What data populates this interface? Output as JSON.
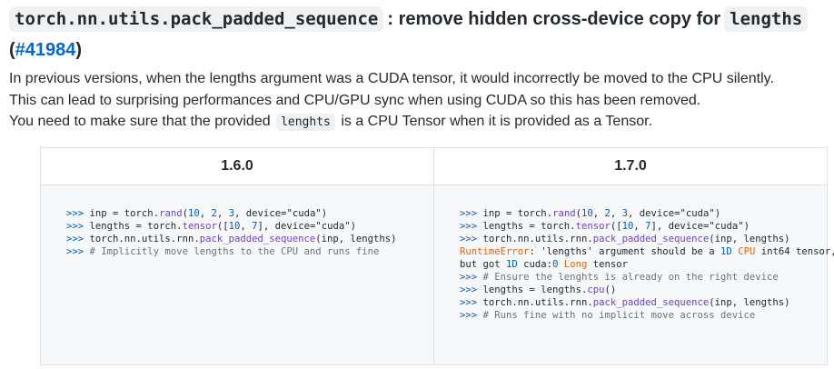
{
  "heading": {
    "code_fn": "torch.nn.utils.pack_padded_sequence",
    "text": ": remove hidden cross-device copy for",
    "code_arg": "lengths",
    "paren_open": "(",
    "link": "#41984",
    "paren_close": ")"
  },
  "paragraph": {
    "line1": "In previous versions, when the lengths argument was a CUDA tensor, it would incorrectly be moved to the CPU silently.",
    "line2": "This can lead to surprising performances and CPU/GPU sync when using CUDA so this has been removed.",
    "line3_pre": "You need to make sure that the provided",
    "line3_code": "lenghts",
    "line3_post": "is a CPU Tensor when it is provided as a Tensor."
  },
  "table": {
    "headers": [
      "1.6.0",
      "1.7.0"
    ],
    "left_code": [
      [
        {
          "t": ">>> ",
          "c": "p"
        },
        {
          "t": "inp = torch."
        },
        {
          "t": "rand",
          "c": "fn"
        },
        {
          "t": "("
        },
        {
          "t": "10",
          "c": "num"
        },
        {
          "t": ", "
        },
        {
          "t": "2",
          "c": "num"
        },
        {
          "t": ", "
        },
        {
          "t": "3",
          "c": "num"
        },
        {
          "t": ", device=\"cuda\")"
        }
      ],
      [
        {
          "t": ">>> ",
          "c": "p"
        },
        {
          "t": "lengths = torch."
        },
        {
          "t": "tensor",
          "c": "fn"
        },
        {
          "t": "(["
        },
        {
          "t": "10",
          "c": "num"
        },
        {
          "t": ", "
        },
        {
          "t": "7",
          "c": "num"
        },
        {
          "t": "], device=\"cuda\")"
        }
      ],
      [
        {
          "t": ">>> ",
          "c": "p"
        },
        {
          "t": "torch.nn.utils.rnn."
        },
        {
          "t": "pack_padded_sequence",
          "c": "fn"
        },
        {
          "t": "(inp, lengths)"
        }
      ],
      [
        {
          "t": ">>> ",
          "c": "p"
        },
        {
          "t": "# Implicitly move lengths to the CPU and runs fine",
          "c": "cm"
        }
      ]
    ],
    "right_code": [
      [
        {
          "t": ">>> ",
          "c": "p"
        },
        {
          "t": "inp = torch."
        },
        {
          "t": "rand",
          "c": "fn"
        },
        {
          "t": "("
        },
        {
          "t": "10",
          "c": "num"
        },
        {
          "t": ", "
        },
        {
          "t": "2",
          "c": "num"
        },
        {
          "t": ", "
        },
        {
          "t": "3",
          "c": "num"
        },
        {
          "t": ", device=\"cuda\")"
        }
      ],
      [
        {
          "t": ">>> ",
          "c": "p"
        },
        {
          "t": "lengths = torch."
        },
        {
          "t": "tensor",
          "c": "fn"
        },
        {
          "t": "(["
        },
        {
          "t": "10",
          "c": "num"
        },
        {
          "t": ", "
        },
        {
          "t": "7",
          "c": "num"
        },
        {
          "t": "], device=\"cuda\")"
        }
      ],
      [
        {
          "t": ">>> ",
          "c": "p"
        },
        {
          "t": "torch.nn.utils.rnn."
        },
        {
          "t": "pack_padded_sequence",
          "c": "fn"
        },
        {
          "t": "(inp, lengths)"
        }
      ],
      [
        {
          "t": "RuntimeError",
          "c": "err"
        },
        {
          "t": ": 'lengths' argument should be a "
        },
        {
          "t": "1D",
          "c": "num"
        },
        {
          "t": " "
        },
        {
          "t": "CPU",
          "c": "err"
        },
        {
          "t": " int64 tensor,"
        }
      ],
      [
        {
          "t": "but got "
        },
        {
          "t": "1D",
          "c": "num"
        },
        {
          "t": " cuda:"
        },
        {
          "t": "0",
          "c": "num"
        },
        {
          "t": " "
        },
        {
          "t": "Long",
          "c": "err"
        },
        {
          "t": " tensor"
        }
      ],
      [
        {
          "t": ">>> ",
          "c": "p"
        },
        {
          "t": "# Ensure the lenghts is already on the right device",
          "c": "cm"
        }
      ],
      [
        {
          "t": ">>> ",
          "c": "p"
        },
        {
          "t": "lengths = lengths."
        },
        {
          "t": "cpu",
          "c": "fn"
        },
        {
          "t": "()"
        }
      ],
      [
        {
          "t": ">>> ",
          "c": "p"
        },
        {
          "t": "torch.nn.utils.rnn."
        },
        {
          "t": "pack_padded_sequence",
          "c": "fn"
        },
        {
          "t": "(inp, lengths)"
        }
      ],
      [
        {
          "t": ">>> ",
          "c": "p"
        },
        {
          "t": "# Runs fine with no implicit move across device",
          "c": "cm"
        }
      ]
    ]
  },
  "colors": {
    "link": "#0366d6",
    "prompt": "#005cc5",
    "function": "#6f42c1",
    "comment": "#6a737d",
    "error": "#e36209"
  }
}
